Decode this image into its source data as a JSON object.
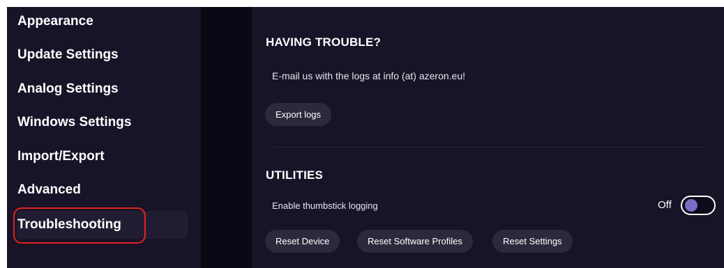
{
  "sidebar": {
    "items": [
      {
        "label": "Appearance"
      },
      {
        "label": "Update Settings"
      },
      {
        "label": "Analog Settings"
      },
      {
        "label": "Windows Settings"
      },
      {
        "label": "Import/Export"
      },
      {
        "label": "Advanced"
      },
      {
        "label": "Troubleshooting",
        "active": true
      }
    ]
  },
  "main": {
    "trouble": {
      "title": "HAVING TROUBLE?",
      "text": "E-mail us with the logs at info (at) azeron.eu!",
      "export_button": "Export logs"
    },
    "utilities": {
      "title": "UTILITIES",
      "thumbstick_label": "Enable thumbstick logging",
      "toggle_state": "Off",
      "buttons": {
        "reset_device": "Reset Device",
        "reset_profiles": "Reset Software Profiles",
        "reset_settings": "Reset Settings"
      }
    }
  },
  "colors": {
    "background": "#0e0a1a",
    "panel": "#181327",
    "button": "#2e283d",
    "toggle_knob": "#7b6cc4",
    "highlight": "#e0261d"
  }
}
